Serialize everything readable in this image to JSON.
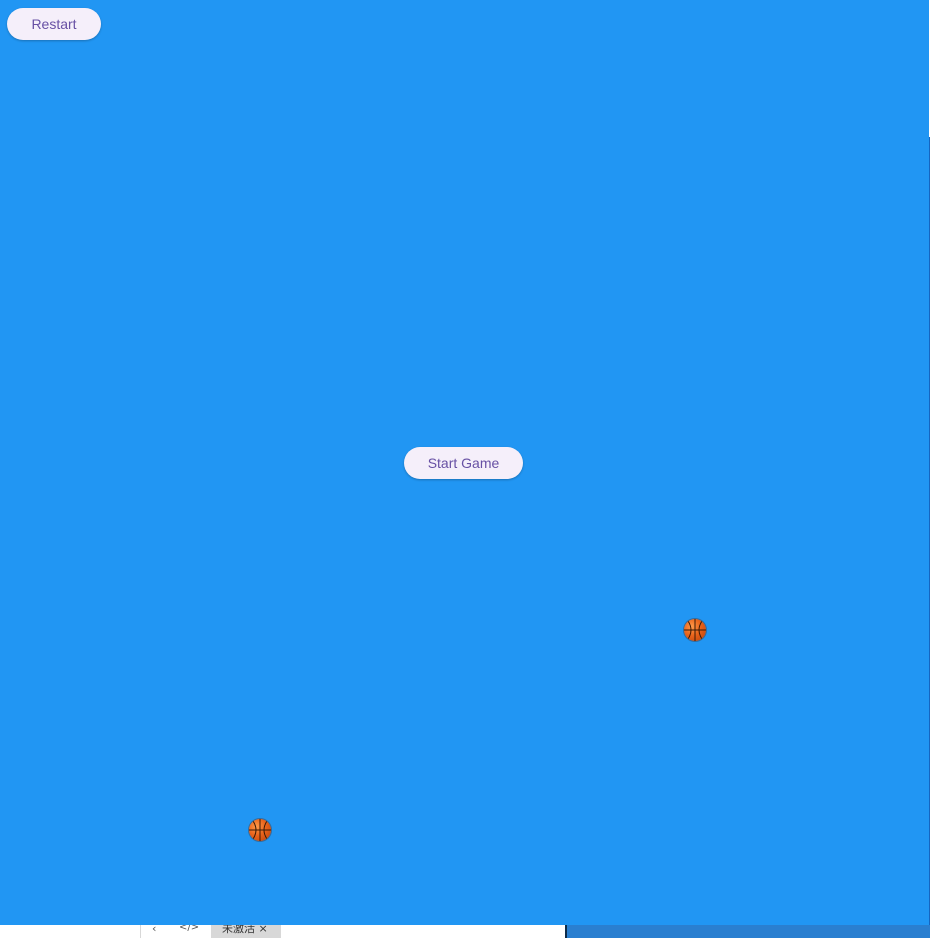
{
  "game": {
    "restart_label": "Restart",
    "start_label": "Start Game",
    "background_color": "#2196f3",
    "button_text_color": "#6750a4",
    "button_bg_color": "#f5effa",
    "balls": [
      {
        "name": "basketball-icon",
        "color": "#e8621a"
      },
      {
        "name": "basketball-icon",
        "color": "#e8621a"
      }
    ]
  },
  "bottom_bar": {
    "back_icon": "chevron-left-icon",
    "code_icon": "code-icon",
    "tab_label": "未激活 ×"
  }
}
